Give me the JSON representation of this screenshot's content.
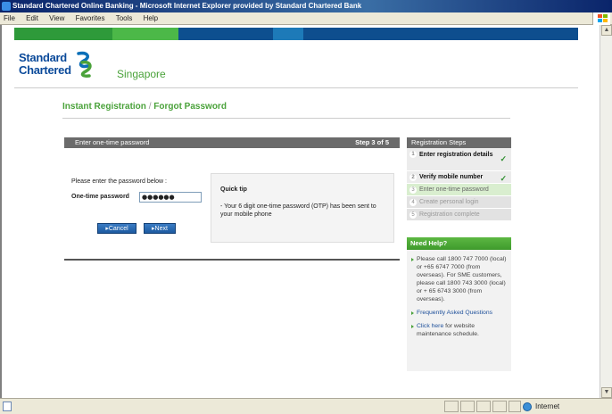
{
  "window": {
    "title": "Standard Chartered Online Banking - Microsoft Internet Explorer provided by Standard Chartered Bank",
    "menu": [
      "File",
      "Edit",
      "View",
      "Favorites",
      "Tools",
      "Help"
    ]
  },
  "brand": {
    "name_line1": "Standard",
    "name_line2": "Chartered",
    "country": "Singapore",
    "strip_colors": [
      "#2e9a3a",
      "#4cb848",
      "#0d4f8f",
      "#1d7ab8",
      "#0e4e8e"
    ]
  },
  "page": {
    "title_part1": "Instant Registration",
    "title_sep": "/",
    "title_part2": "Forgot Password"
  },
  "otp_panel": {
    "header": "Enter one-time password",
    "step": "Step 3 of 5",
    "instruction": "Please enter the password below :",
    "field_label": "One-time password",
    "field_value": "●●●●●●",
    "cancel_label": "▸Cancel",
    "next_label": "▸Next",
    "tip_title": "Quick tip",
    "tip_text": "- Your 6 digit one-time password (OTP) has been sent to your mobile phone"
  },
  "steps": {
    "header": "Registration Steps",
    "items": [
      {
        "num": "1",
        "label": "Enter registration details",
        "state": "done"
      },
      {
        "num": "2",
        "label": "Verify mobile number",
        "state": "done"
      },
      {
        "num": "3",
        "label": "Enter one-time password",
        "state": "current"
      },
      {
        "num": "4",
        "label": "Create personal login",
        "state": "pending"
      },
      {
        "num": "5",
        "label": "Registration complete",
        "state": "pending"
      }
    ]
  },
  "help": {
    "header": "Need Help?",
    "call_text": "Please call 1800 747 7000 (local) or +65 6747 7000 (from overseas). For SME customers, please call 1800 743 3000 (local) or + 65 6743 3000 (from overseas).",
    "faq_link": "Frequently Asked Questions",
    "click_here": "Click here",
    "maintenance_text": " for website maintenance schedule."
  },
  "status": {
    "zone": "Internet"
  }
}
